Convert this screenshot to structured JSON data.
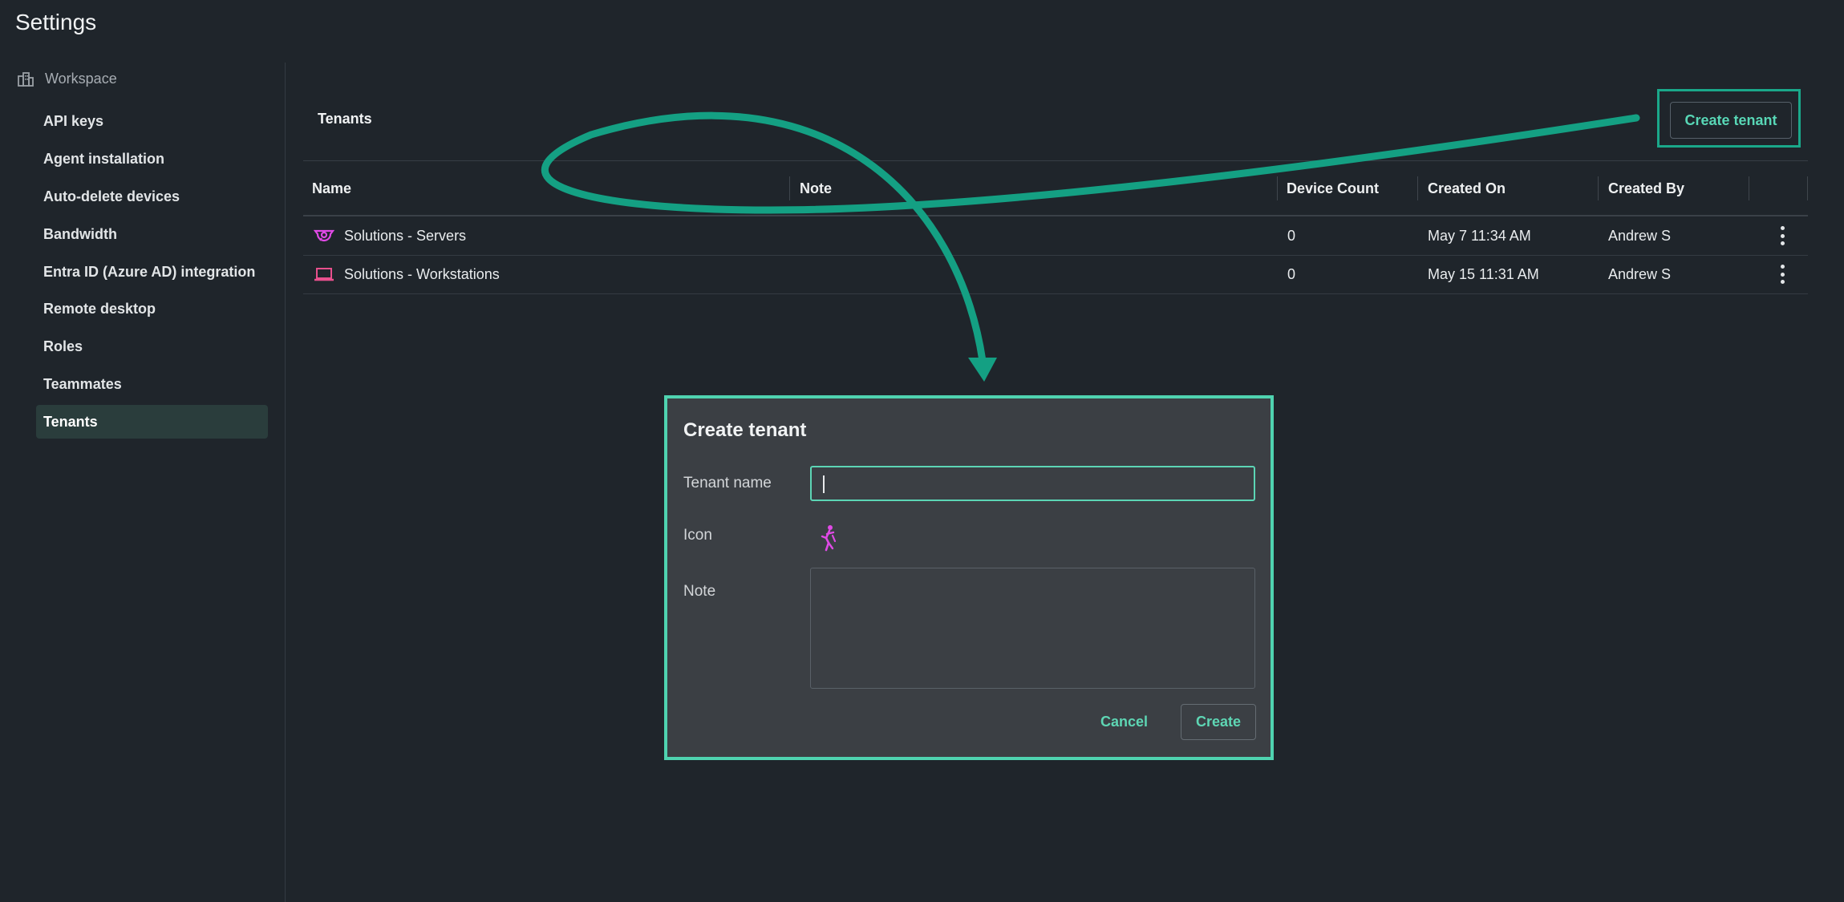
{
  "app": {
    "title": "Settings"
  },
  "sidebar": {
    "section": {
      "label": "Workspace",
      "icon": "building-icon"
    },
    "items": [
      {
        "label": "API keys"
      },
      {
        "label": "Agent installation"
      },
      {
        "label": "Auto-delete devices"
      },
      {
        "label": "Bandwidth"
      },
      {
        "label": "Entra ID (Azure AD) integration"
      },
      {
        "label": "Remote desktop"
      },
      {
        "label": "Roles"
      },
      {
        "label": "Teammates"
      },
      {
        "label": "Tenants",
        "active": true
      }
    ]
  },
  "main": {
    "header": "Tenants",
    "create_button": "Create tenant",
    "table": {
      "columns": [
        "Name",
        "Note",
        "Device Count",
        "Created On",
        "Created By"
      ],
      "rows": [
        {
          "icon": "gear-speech-icon",
          "name": "Solutions - Servers",
          "note": "",
          "device_count": "0",
          "created_on": "May 7 11:34 AM",
          "created_by": "Andrew S"
        },
        {
          "icon": "laptop-icon",
          "name": "Solutions - Workstations",
          "note": "",
          "device_count": "0",
          "created_on": "May 15 11:31 AM",
          "created_by": "Andrew S"
        }
      ]
    }
  },
  "dialog": {
    "title": "Create tenant",
    "tenant_name_label": "Tenant name",
    "tenant_name_value": "",
    "icon_label": "Icon",
    "icon": "dancer-icon",
    "note_label": "Note",
    "note_value": "",
    "cancel": "Cancel",
    "create": "Create"
  },
  "colors": {
    "accent": "#4fd3b0",
    "annotation": "#1aa88a",
    "icon_magenta": "#e04ae6",
    "icon_pink": "#e8508d"
  }
}
